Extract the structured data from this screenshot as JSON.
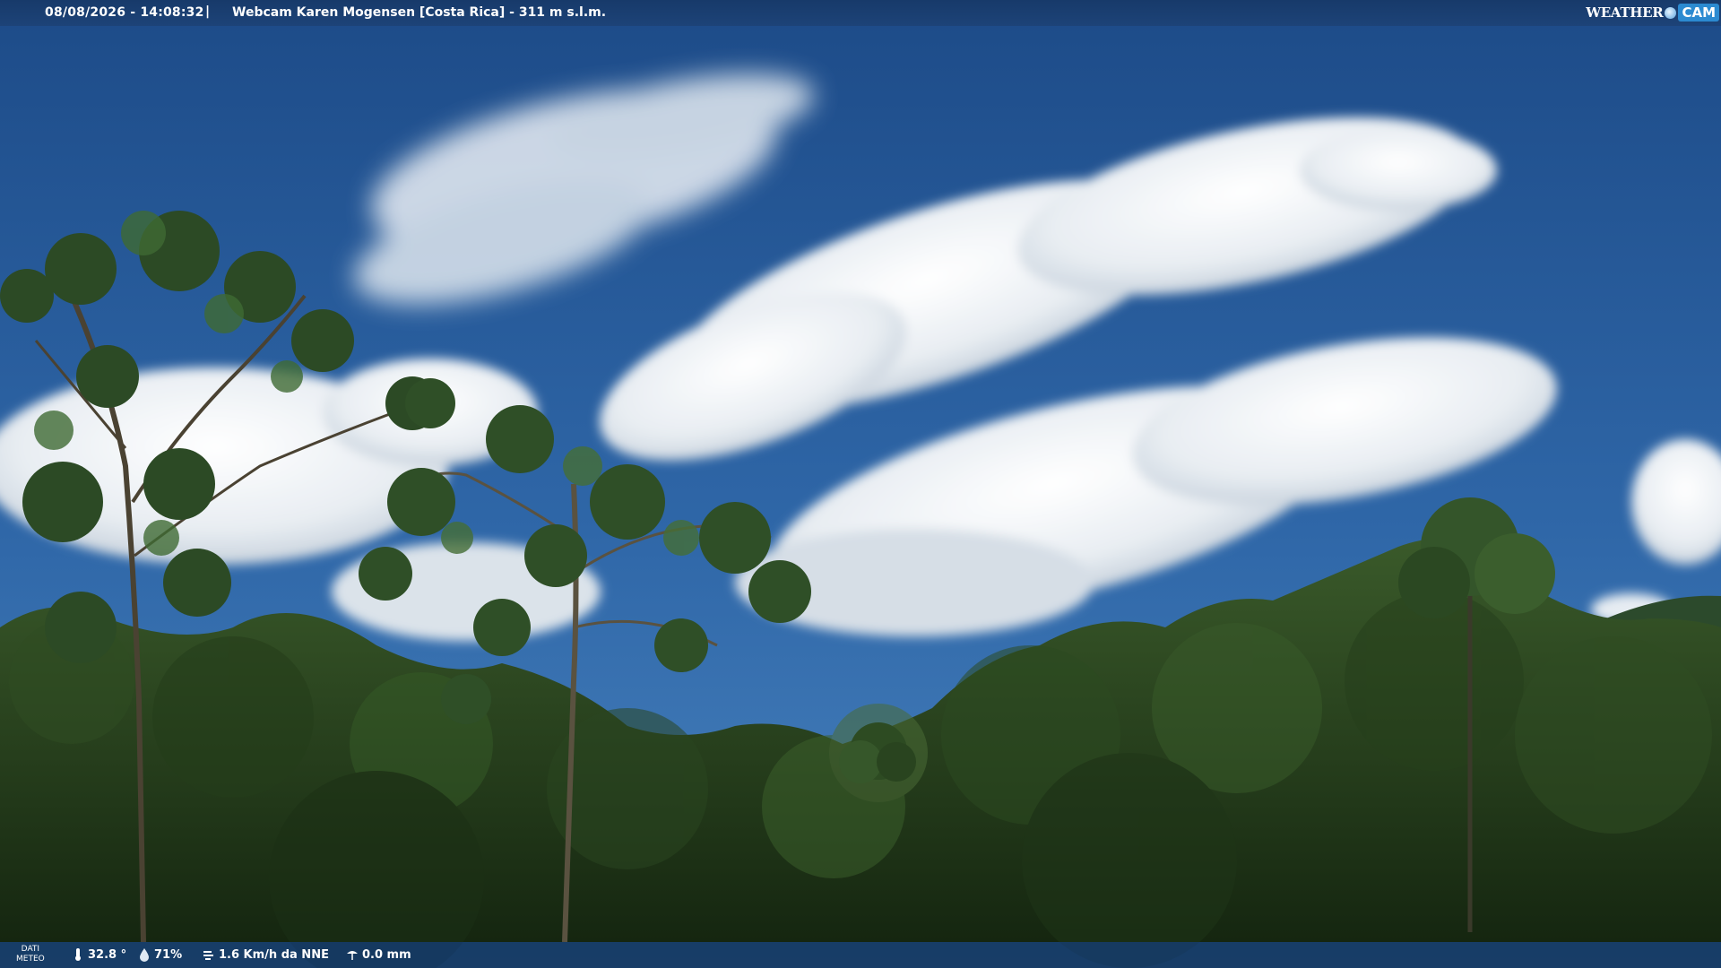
{
  "header": {
    "datetime": "08/08/2026 - 14:08:32",
    "separator": "|",
    "title": "Webcam Karen Mogensen [Costa Rica]  - 311 m s.l.m."
  },
  "logo": {
    "weather": "WEATHER",
    "cam": "CAM"
  },
  "footer": {
    "label_line1": "DATI",
    "label_line2": "METEO",
    "temperature": "32.8 °",
    "humidity": "71%",
    "wind": "1.6 Km/h da NNE",
    "rain": "0.0 mm"
  },
  "colors": {
    "sky_top": "#1f4f8f",
    "sky_bottom": "#3f79b8",
    "forest_dark": "#1a2e14",
    "forest_mid": "#2f4d22",
    "cloud": "#f2f5f8"
  },
  "icons": [
    "thermometer-icon",
    "humidity-drop-icon",
    "wind-icon",
    "rain-gauge-icon"
  ]
}
